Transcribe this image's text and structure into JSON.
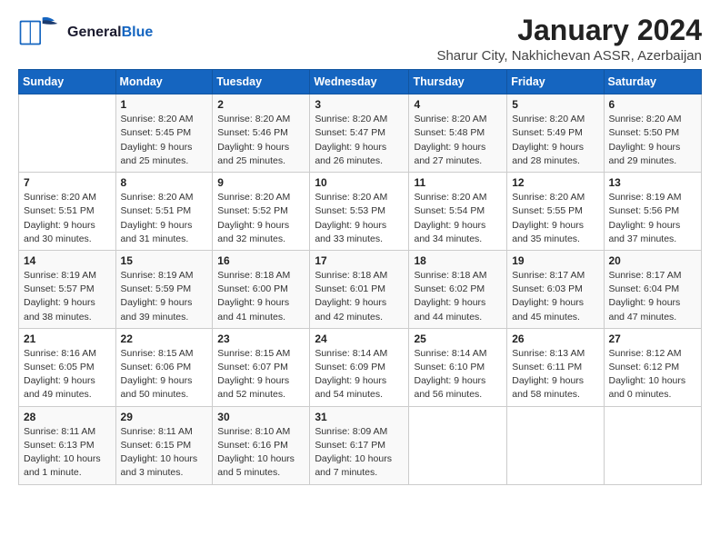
{
  "header": {
    "logo_general": "General",
    "logo_blue": "Blue",
    "month": "January 2024",
    "location": "Sharur City, Nakhichevan ASSR, Azerbaijan"
  },
  "weekdays": [
    "Sunday",
    "Monday",
    "Tuesday",
    "Wednesday",
    "Thursday",
    "Friday",
    "Saturday"
  ],
  "weeks": [
    [
      {
        "day": "",
        "info": ""
      },
      {
        "day": "1",
        "info": "Sunrise: 8:20 AM\nSunset: 5:45 PM\nDaylight: 9 hours\nand 25 minutes."
      },
      {
        "day": "2",
        "info": "Sunrise: 8:20 AM\nSunset: 5:46 PM\nDaylight: 9 hours\nand 25 minutes."
      },
      {
        "day": "3",
        "info": "Sunrise: 8:20 AM\nSunset: 5:47 PM\nDaylight: 9 hours\nand 26 minutes."
      },
      {
        "day": "4",
        "info": "Sunrise: 8:20 AM\nSunset: 5:48 PM\nDaylight: 9 hours\nand 27 minutes."
      },
      {
        "day": "5",
        "info": "Sunrise: 8:20 AM\nSunset: 5:49 PM\nDaylight: 9 hours\nand 28 minutes."
      },
      {
        "day": "6",
        "info": "Sunrise: 8:20 AM\nSunset: 5:50 PM\nDaylight: 9 hours\nand 29 minutes."
      }
    ],
    [
      {
        "day": "7",
        "info": "Sunrise: 8:20 AM\nSunset: 5:51 PM\nDaylight: 9 hours\nand 30 minutes."
      },
      {
        "day": "8",
        "info": "Sunrise: 8:20 AM\nSunset: 5:51 PM\nDaylight: 9 hours\nand 31 minutes."
      },
      {
        "day": "9",
        "info": "Sunrise: 8:20 AM\nSunset: 5:52 PM\nDaylight: 9 hours\nand 32 minutes."
      },
      {
        "day": "10",
        "info": "Sunrise: 8:20 AM\nSunset: 5:53 PM\nDaylight: 9 hours\nand 33 minutes."
      },
      {
        "day": "11",
        "info": "Sunrise: 8:20 AM\nSunset: 5:54 PM\nDaylight: 9 hours\nand 34 minutes."
      },
      {
        "day": "12",
        "info": "Sunrise: 8:20 AM\nSunset: 5:55 PM\nDaylight: 9 hours\nand 35 minutes."
      },
      {
        "day": "13",
        "info": "Sunrise: 8:19 AM\nSunset: 5:56 PM\nDaylight: 9 hours\nand 37 minutes."
      }
    ],
    [
      {
        "day": "14",
        "info": "Sunrise: 8:19 AM\nSunset: 5:57 PM\nDaylight: 9 hours\nand 38 minutes."
      },
      {
        "day": "15",
        "info": "Sunrise: 8:19 AM\nSunset: 5:59 PM\nDaylight: 9 hours\nand 39 minutes."
      },
      {
        "day": "16",
        "info": "Sunrise: 8:18 AM\nSunset: 6:00 PM\nDaylight: 9 hours\nand 41 minutes."
      },
      {
        "day": "17",
        "info": "Sunrise: 8:18 AM\nSunset: 6:01 PM\nDaylight: 9 hours\nand 42 minutes."
      },
      {
        "day": "18",
        "info": "Sunrise: 8:18 AM\nSunset: 6:02 PM\nDaylight: 9 hours\nand 44 minutes."
      },
      {
        "day": "19",
        "info": "Sunrise: 8:17 AM\nSunset: 6:03 PM\nDaylight: 9 hours\nand 45 minutes."
      },
      {
        "day": "20",
        "info": "Sunrise: 8:17 AM\nSunset: 6:04 PM\nDaylight: 9 hours\nand 47 minutes."
      }
    ],
    [
      {
        "day": "21",
        "info": "Sunrise: 8:16 AM\nSunset: 6:05 PM\nDaylight: 9 hours\nand 49 minutes."
      },
      {
        "day": "22",
        "info": "Sunrise: 8:15 AM\nSunset: 6:06 PM\nDaylight: 9 hours\nand 50 minutes."
      },
      {
        "day": "23",
        "info": "Sunrise: 8:15 AM\nSunset: 6:07 PM\nDaylight: 9 hours\nand 52 minutes."
      },
      {
        "day": "24",
        "info": "Sunrise: 8:14 AM\nSunset: 6:09 PM\nDaylight: 9 hours\nand 54 minutes."
      },
      {
        "day": "25",
        "info": "Sunrise: 8:14 AM\nSunset: 6:10 PM\nDaylight: 9 hours\nand 56 minutes."
      },
      {
        "day": "26",
        "info": "Sunrise: 8:13 AM\nSunset: 6:11 PM\nDaylight: 9 hours\nand 58 minutes."
      },
      {
        "day": "27",
        "info": "Sunrise: 8:12 AM\nSunset: 6:12 PM\nDaylight: 10 hours\nand 0 minutes."
      }
    ],
    [
      {
        "day": "28",
        "info": "Sunrise: 8:11 AM\nSunset: 6:13 PM\nDaylight: 10 hours\nand 1 minute."
      },
      {
        "day": "29",
        "info": "Sunrise: 8:11 AM\nSunset: 6:15 PM\nDaylight: 10 hours\nand 3 minutes."
      },
      {
        "day": "30",
        "info": "Sunrise: 8:10 AM\nSunset: 6:16 PM\nDaylight: 10 hours\nand 5 minutes."
      },
      {
        "day": "31",
        "info": "Sunrise: 8:09 AM\nSunset: 6:17 PM\nDaylight: 10 hours\nand 7 minutes."
      },
      {
        "day": "",
        "info": ""
      },
      {
        "day": "",
        "info": ""
      },
      {
        "day": "",
        "info": ""
      }
    ]
  ]
}
